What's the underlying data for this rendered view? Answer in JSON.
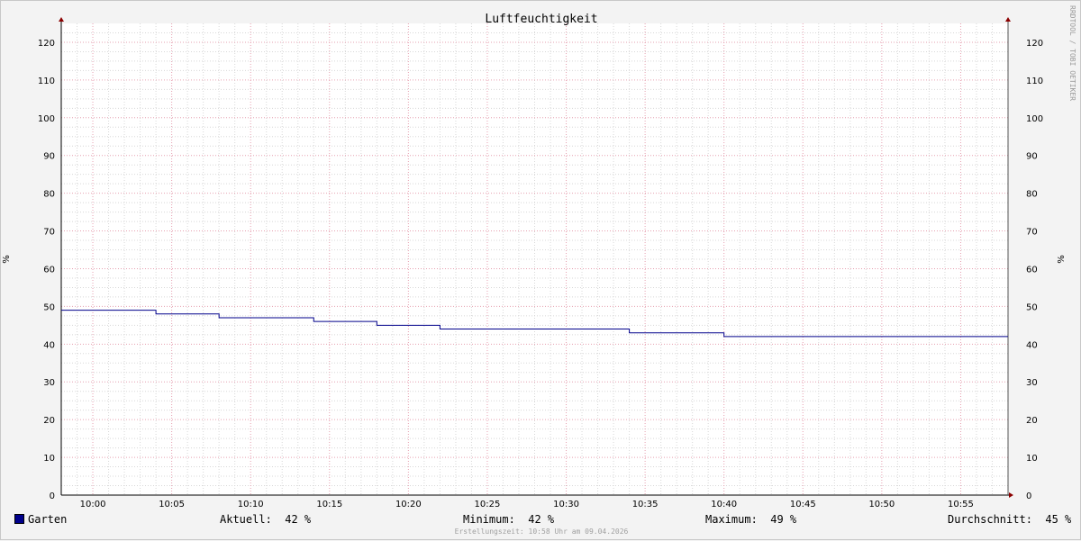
{
  "chart_data": {
    "type": "line",
    "title": "Luftfeuchtigkeit",
    "ylabel": "%",
    "ylabel_right": "%",
    "ylim": [
      0,
      125
    ],
    "y_ticks": [
      0,
      10,
      20,
      30,
      40,
      50,
      60,
      70,
      80,
      90,
      100,
      110,
      120
    ],
    "x_ticks": [
      "10:00",
      "10:05",
      "10:10",
      "10:15",
      "10:20",
      "10:25",
      "10:30",
      "10:35",
      "10:40",
      "10:45",
      "10:50",
      "10:55"
    ],
    "x_start_time": "09:58",
    "x_end_time": "10:58",
    "grid": true,
    "legend_position": "bottom",
    "side_text": "RRDTOOL / TOBI OETIKER",
    "series": [
      {
        "name": "Garten",
        "color": "#00008b",
        "points": [
          {
            "t": "09:58",
            "v": 49
          },
          {
            "t": "10:04",
            "v": 48
          },
          {
            "t": "10:08",
            "v": 47
          },
          {
            "t": "10:14",
            "v": 46
          },
          {
            "t": "10:18",
            "v": 45
          },
          {
            "t": "10:22",
            "v": 44
          },
          {
            "t": "10:34",
            "v": 43
          },
          {
            "t": "10:40",
            "v": 42
          },
          {
            "t": "10:58",
            "v": 42
          }
        ]
      }
    ]
  },
  "legend": {
    "series_label": "Garten",
    "aktuell": "Aktuell:  42 %",
    "minimum": "Minimum:  42 %",
    "maximum": "Maximum:  49 %",
    "durchschnitt": "Durchschnitt:  45 %"
  },
  "footer": "Erstellungszeit: 10:58 Uhr am 09.04.2026",
  "colors": {
    "background": "#f3f3f3",
    "plot_background": "#ffffff",
    "major_grid": "#e6a0b0",
    "minor_grid": "#d8d8d8",
    "series": "#00008b",
    "arrow": "#8b0000"
  }
}
